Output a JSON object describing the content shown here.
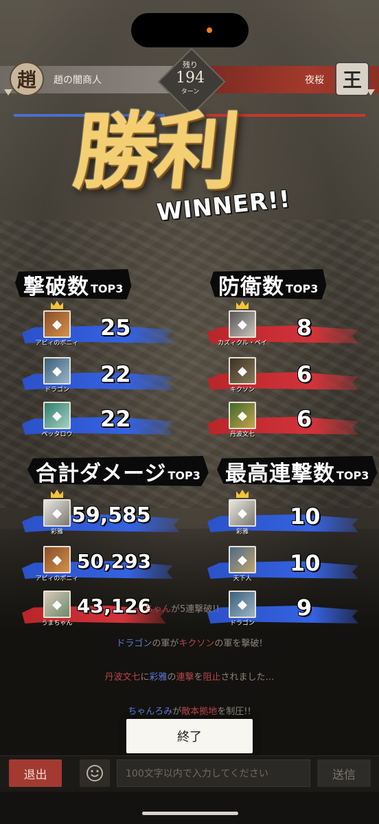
{
  "header": {
    "left_player": "趙の闇商人",
    "left_emblem": "趙",
    "right_player": "夜桜",
    "right_emblem": "王",
    "turns_label": "残り",
    "turns_value": "194",
    "turns_unit": "ターン"
  },
  "result": {
    "title": "勝利",
    "subtitle": "WINNER!!"
  },
  "categories": [
    {
      "title": "撃破数",
      "tag": "TOP3",
      "entries": [
        {
          "name": "アビィのボニィ",
          "value": "25",
          "color": "blue",
          "crown": true
        },
        {
          "name": "ドラゴン",
          "value": "22",
          "color": "blue",
          "crown": false
        },
        {
          "name": "ペッタロウ",
          "value": "22",
          "color": "blue",
          "crown": false
        }
      ]
    },
    {
      "title": "防衛数",
      "tag": "TOP3",
      "entries": [
        {
          "name": "カズィクル・ベイ",
          "value": "8",
          "color": "red",
          "crown": true
        },
        {
          "name": "キクソン",
          "value": "6",
          "color": "red",
          "crown": false
        },
        {
          "name": "丹波文七",
          "value": "6",
          "color": "red",
          "crown": false
        }
      ]
    },
    {
      "title": "合計ダメージ",
      "tag": "TOP3",
      "entries": [
        {
          "name": "彩雅",
          "value": "59,585",
          "color": "blue",
          "crown": true
        },
        {
          "name": "アビィのボニィ",
          "value": "50,293",
          "color": "blue",
          "crown": false
        },
        {
          "name": "うまちゃん",
          "value": "43,126",
          "color": "red",
          "crown": false
        }
      ]
    },
    {
      "title": "最高連撃数",
      "tag": "TOP3",
      "entries": [
        {
          "name": "彩雅",
          "value": "10",
          "color": "blue",
          "crown": true
        },
        {
          "name": "天下人",
          "value": "10",
          "color": "blue",
          "crown": false
        },
        {
          "name": "ドラゴン",
          "value": "9",
          "color": "blue",
          "crown": false
        }
      ]
    }
  ],
  "log": {
    "line1_b": "ちゃん",
    "line1_rest": "が5連撃破!!",
    "line2_a": "ドラゴン",
    "line2_b": "の軍が",
    "line2_c": "キクソン",
    "line2_d": "の軍を撃破!",
    "line3_a": "丹波文七",
    "line3_b": "に",
    "line3_c": "彩雅",
    "line3_d": "の",
    "line3_e": "連撃",
    "line3_f": "を",
    "line3_g": "阻止",
    "line3_h": "されました…",
    "line4_a": "ちゃんろみ",
    "line4_b": "が",
    "line4_c": "敵本拠地",
    "line4_d": "を制圧!!"
  },
  "buttons": {
    "finish": "終了",
    "leave": "退出",
    "send": "送信"
  },
  "chat": {
    "placeholder": "100文字以内で入力してください"
  },
  "colors": {
    "blue_team": "#3562e0",
    "red_team": "#d2333a",
    "gold": "#f4cf72"
  }
}
